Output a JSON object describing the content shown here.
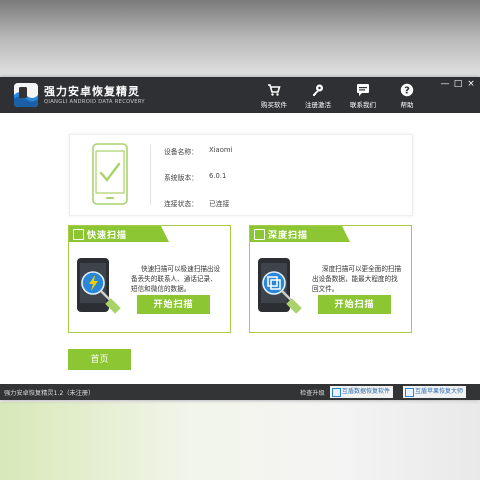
{
  "app": {
    "title": "强力安卓恢复精灵",
    "subtitle": "QIANGLI ANDROID DATA RECOVERY"
  },
  "toolbar": [
    {
      "label": "购买软件",
      "icon": "cart-icon"
    },
    {
      "label": "注册激活",
      "icon": "key-icon"
    },
    {
      "label": "联系我们",
      "icon": "chat-icon"
    },
    {
      "label": "帮助",
      "icon": "help-icon"
    }
  ],
  "window_controls": [
    "—",
    "□",
    "×"
  ],
  "device": {
    "rows": [
      {
        "label": "设备名称：",
        "value": "Xiaomi"
      },
      {
        "label": "系统版本：",
        "value": "6.0.1"
      },
      {
        "label": "连接状态：",
        "value": "已连接"
      }
    ]
  },
  "scans": [
    {
      "title": "快速扫描",
      "desc": "快速扫描可以极速扫描出设备丢失的联系人、通话记录、短信和微信的数据。",
      "button": "开始扫描",
      "icon": "lightning-icon"
    },
    {
      "title": "深度扫描",
      "desc": "深度扫描可以更全面的扫描出设备数据，能最大程度的找回文件。",
      "button": "开始扫描",
      "icon": "layers-icon"
    }
  ],
  "home_button": "首页",
  "status": {
    "version": "强力安卓恢复精灵1.2（未注册）",
    "update_label": "检查升级",
    "links": [
      "互盾数据恢复软件",
      "互盾苹果恢复大师"
    ]
  },
  "colors": {
    "accent_green": "#8cc633",
    "titlebar": "#2f3033",
    "statusbar": "#333436"
  }
}
